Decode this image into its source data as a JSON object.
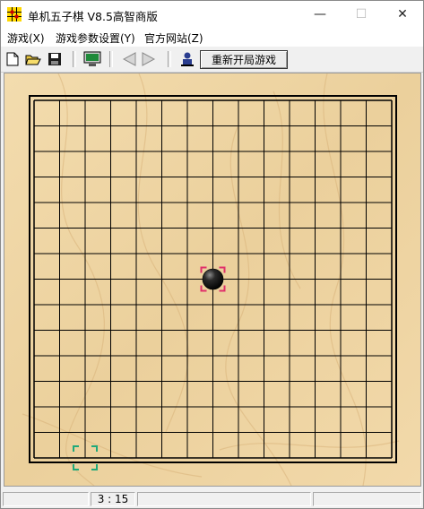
{
  "window": {
    "title": "单机五子棋 V8.5高智商版",
    "minimize_glyph": "—",
    "maximize_glyph": "☐",
    "close_glyph": "✕"
  },
  "menu": [
    {
      "label": "游戏(X)"
    },
    {
      "label": "游戏参数设置(Y)"
    },
    {
      "label": "官方网站(Z)"
    }
  ],
  "toolbar": {
    "icons": [
      "new-file-icon",
      "open-folder-icon",
      "save-disk-icon",
      "monitor-icon",
      "undo-arrow-icon",
      "redo-arrow-icon",
      "player-icon"
    ],
    "restart_label": "重新开局游戏"
  },
  "board": {
    "size": 15,
    "stones": [
      {
        "color": "black",
        "col": 7,
        "row": 7
      }
    ],
    "last_move_marker": {
      "col": 7,
      "row": 7,
      "color": "#e0306a"
    },
    "cursor_marker": {
      "col": 2,
      "row": 14,
      "color": "#1fa97a"
    },
    "wood_color": "#efd7a8",
    "line_color": "#000000"
  },
  "status": {
    "cell1": "",
    "timer": "3 : 15",
    "cell3": "",
    "cell4": ""
  }
}
